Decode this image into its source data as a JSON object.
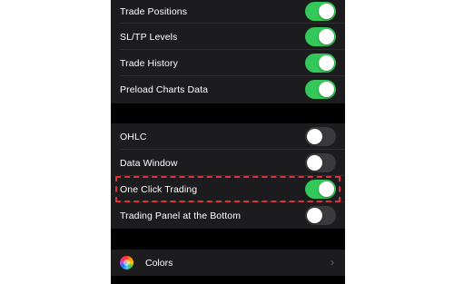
{
  "group1": {
    "items": [
      {
        "label": "Trade Positions",
        "on": true
      },
      {
        "label": "SL/TP Levels",
        "on": true
      },
      {
        "label": "Trade History",
        "on": true
      },
      {
        "label": "Preload Charts Data",
        "on": true
      }
    ]
  },
  "group2": {
    "items": [
      {
        "label": "OHLC",
        "on": false
      },
      {
        "label": "Data Window",
        "on": false
      },
      {
        "label": "One Click Trading",
        "on": true
      },
      {
        "label": "Trading Panel at the Bottom",
        "on": false
      }
    ]
  },
  "colors": {
    "label": "Colors",
    "icon": "color-wheel-icon",
    "chevron": "›"
  },
  "theme": {
    "toggle_on": "#34c759",
    "toggle_off": "#3a3a3c",
    "highlight": "#e0303a"
  }
}
